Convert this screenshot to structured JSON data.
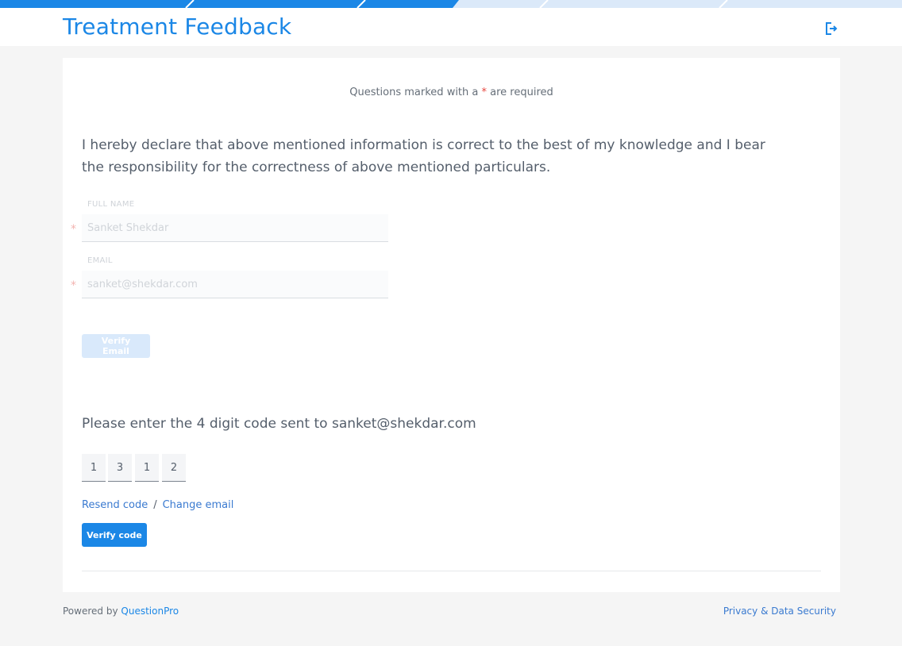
{
  "header": {
    "title": "Treatment Feedback",
    "logout_icon": "logout-icon"
  },
  "colors": {
    "accent": "#1b87e6",
    "required_star": "#e7463f",
    "background": "#f5f5f5"
  },
  "form": {
    "required_note_prefix": "Questions marked with a",
    "required_note_star": "*",
    "required_note_suffix": "are required",
    "declaration": "I hereby declare that above mentioned information is correct to the best of my knowledge and I bear the responsibility for the correctness of above mentioned particulars.",
    "full_name": {
      "label": "FULL NAME",
      "value": "Sanket Shekdar",
      "required_mark": "*"
    },
    "email": {
      "label": "EMAIL",
      "value": "sanket@shekdar.com",
      "required_mark": "*"
    },
    "verify_email_label": "Verify Email"
  },
  "verification": {
    "prompt": "Please enter the 4 digit code sent to sanket@shekdar.com",
    "code_digits": [
      "1",
      "3",
      "1",
      "2"
    ],
    "resend_label": "Resend code",
    "separator": "/",
    "change_email_label": "Change email",
    "verify_code_label": "Verify code"
  },
  "footer": {
    "powered_by": "Powered by",
    "brand": "QuestionPro",
    "privacy_link": "Privacy & Data Security"
  }
}
